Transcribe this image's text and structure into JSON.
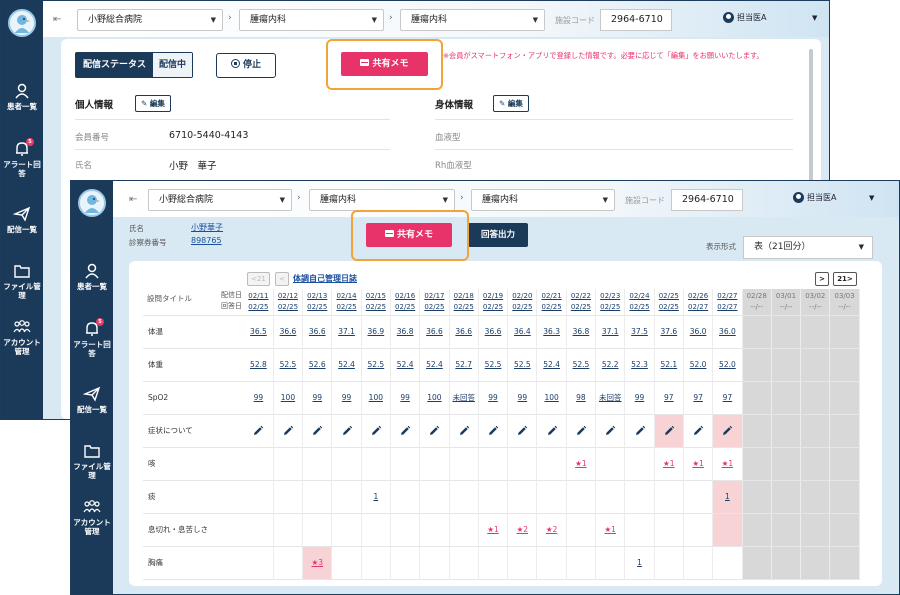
{
  "colors": {
    "navy": "#1b3a5a",
    "memo_pink": "#e8336a",
    "highlight_orange": "#f2a33a",
    "future_gray": "#d8d8d8",
    "alert_pink": "#f8d3d6"
  },
  "sidebar": {
    "items": [
      {
        "label": "患者一覧",
        "icon": "patients-icon"
      },
      {
        "label": "アラート回答",
        "icon": "bell-icon",
        "badge": "5"
      },
      {
        "label": "配信一覧",
        "icon": "paper-plane-icon"
      },
      {
        "label": "ファイル管理",
        "icon": "folder-icon"
      },
      {
        "label": "アカウント管理",
        "icon": "users-icon"
      }
    ]
  },
  "topbar": {
    "hospital": "小野総合病院",
    "dept1": "腫瘍内科",
    "dept2": "腫瘍内科",
    "facility_label": "施設コード",
    "facility_code": "2964-6710",
    "user": "担当医A"
  },
  "back": {
    "status_label": "配信ステータス",
    "status_value": "配信中",
    "stop_label": "停止",
    "memo_label": "共有メモ",
    "notice": "※会員がスマートフォン・アプリで登録した情報です。必要に応じて「編集」をお願いいたします。",
    "personal_title": "個人情報",
    "body_title": "身体情報",
    "edit_label": "編集",
    "member_no_label": "会員番号",
    "member_no": "6710-5440-4143",
    "name_label": "氏名",
    "name": "小野　華子",
    "blood_label": "血液型",
    "rh_label": "Rh血液型"
  },
  "front": {
    "name_label": "氏名",
    "name": "小野華子",
    "medno_label": "診察券番号",
    "medno": "898765",
    "memo_label": "共有メモ",
    "reply_label": "回答出力",
    "display_label": "表示形式",
    "display_value": "表（21回分）",
    "pager_prev": "<21",
    "pager_prev_one": "<",
    "pager_next_one": ">",
    "pager_next": "21>",
    "diary_link": "体調自己管理日誌",
    "corner_title": "設問タイトル",
    "corner_dates": [
      "配信日",
      "回答日"
    ],
    "dates": [
      [
        "02/11",
        "02/25"
      ],
      [
        "02/12",
        "02/25"
      ],
      [
        "02/13",
        "02/25"
      ],
      [
        "02/14",
        "02/25"
      ],
      [
        "02/15",
        "02/25"
      ],
      [
        "02/16",
        "02/25"
      ],
      [
        "02/17",
        "02/25"
      ],
      [
        "02/18",
        "02/25"
      ],
      [
        "02/19",
        "02/25"
      ],
      [
        "02/20",
        "02/25"
      ],
      [
        "02/21",
        "02/25"
      ],
      [
        "02/22",
        "02/25"
      ],
      [
        "02/23",
        "02/25"
      ],
      [
        "02/24",
        "02/25"
      ],
      [
        "02/25",
        "02/25"
      ],
      [
        "02/26",
        "02/27"
      ],
      [
        "02/27",
        "02/27"
      ],
      [
        "02/28",
        "--/--"
      ],
      [
        "03/01",
        "--/--"
      ],
      [
        "03/02",
        "--/--"
      ],
      [
        "03/03",
        "--/--"
      ]
    ],
    "future_from": 17,
    "rows": [
      {
        "label": "体温",
        "values": [
          "36.5",
          "36.6",
          "36.6",
          "37.1",
          "36.9",
          "36.8",
          "36.6",
          "36.6",
          "36.6",
          "36.4",
          "36.3",
          "36.8",
          "37.1",
          "37.5",
          "37.6",
          "36.0",
          "36.0"
        ]
      },
      {
        "label": "体重",
        "values": [
          "52.8",
          "52.5",
          "52.6",
          "52.4",
          "52.5",
          "52.4",
          "52.4",
          "52.7",
          "52.5",
          "52.5",
          "52.4",
          "52.5",
          "52.2",
          "52.3",
          "52.1",
          "52.0",
          "52.0"
        ]
      },
      {
        "label": "SpO2",
        "values": [
          "99",
          "100",
          "99",
          "99",
          "100",
          "99",
          "100",
          "未回答",
          "99",
          "99",
          "100",
          "98",
          "未回答",
          "99",
          "97",
          "97",
          "97"
        ]
      },
      {
        "label": "症状について",
        "values": [
          "edit",
          "edit",
          "edit",
          "edit",
          "edit",
          "edit",
          "edit",
          "edit",
          "edit",
          "edit",
          "edit",
          "edit",
          "edit",
          "edit",
          "edit",
          "edit",
          "edit"
        ],
        "pink": [
          14,
          16
        ]
      },
      {
        "label": "咳",
        "values": [
          "",
          "",
          "",
          "",
          "",
          "",
          "",
          "",
          "",
          "",
          "",
          "★1",
          "",
          "",
          "★1",
          "★1",
          "★1"
        ]
      },
      {
        "label": "痰",
        "values": [
          "",
          "",
          "",
          "",
          "1",
          "",
          "",
          "",
          "",
          "",
          "",
          "",
          "",
          "",
          "",
          "",
          "1"
        ],
        "pink": [
          16
        ]
      },
      {
        "label": "息切れ・息苦しさ",
        "values": [
          "",
          "",
          "",
          "",
          "",
          "",
          "",
          "",
          "★1",
          "★2",
          "★2",
          "",
          "★1",
          "",
          "",
          "",
          ""
        ],
        "pink": [
          16
        ]
      },
      {
        "label": "胸痛",
        "values": [
          "",
          "",
          "★3",
          "",
          "",
          "",
          "",
          "",
          "",
          "",
          "",
          "",
          "",
          "1",
          "",
          "",
          ""
        ],
        "pink": [
          2
        ]
      }
    ]
  }
}
